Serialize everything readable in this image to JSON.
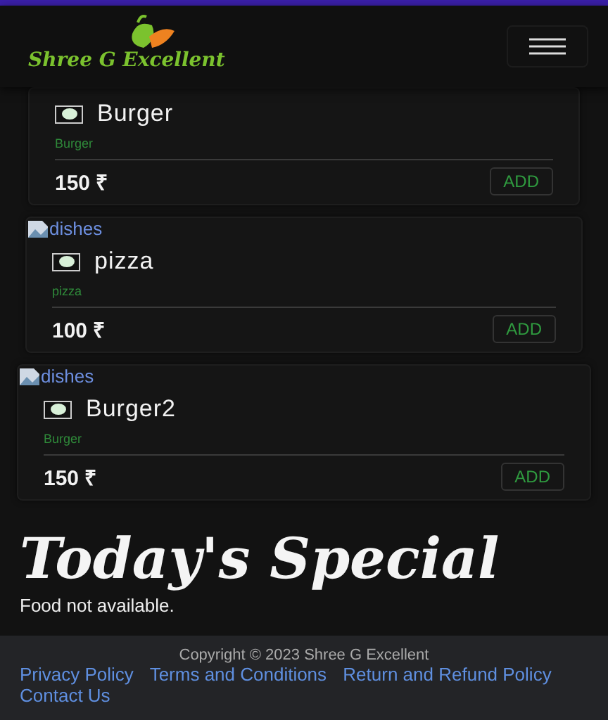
{
  "header": {
    "brand": "Shree G Excellent"
  },
  "dishes": [
    {
      "name": "Burger",
      "category": "Burger",
      "price": "150 ₹",
      "button": "ADD"
    },
    {
      "image_alt": "dishes",
      "name": "pizza",
      "category": "pizza",
      "price": "100 ₹",
      "button": "ADD"
    },
    {
      "image_alt": "dishes",
      "name": "Burger2",
      "category": "Burger",
      "price": "150 ₹",
      "button": "ADD"
    }
  ],
  "special": {
    "title": "Today's Special",
    "message": "Food not available."
  },
  "footer": {
    "copyright": "Copyright © 2023 Shree G Excellent",
    "links": [
      "Privacy Policy",
      "Terms and Conditions",
      "Return and Refund Policy",
      "Contact Us"
    ]
  }
}
